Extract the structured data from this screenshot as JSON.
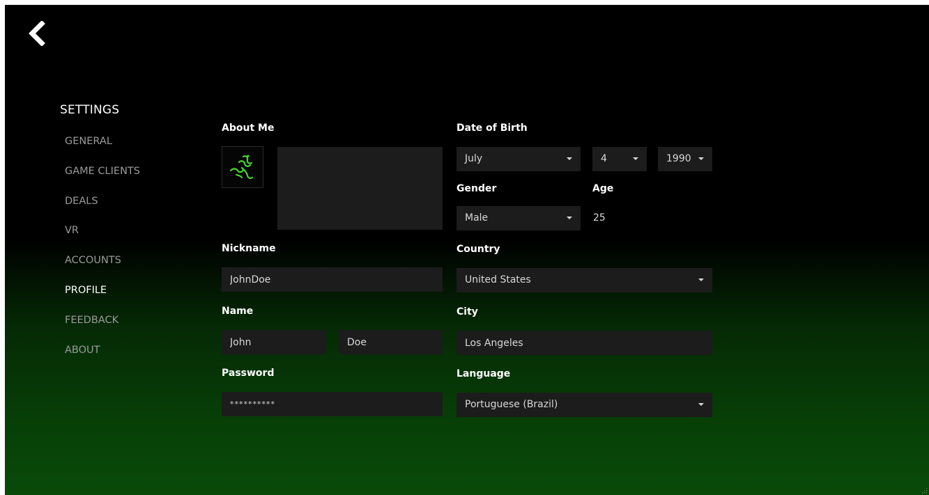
{
  "nav": {
    "title": "SETTINGS",
    "items": [
      {
        "label": "GENERAL",
        "active": false
      },
      {
        "label": "GAME CLIENTS",
        "active": false
      },
      {
        "label": "DEALS",
        "active": false
      },
      {
        "label": "VR",
        "active": false
      },
      {
        "label": "ACCOUNTS",
        "active": false
      },
      {
        "label": "PROFILE",
        "active": true
      },
      {
        "label": "FEEDBACK",
        "active": false
      },
      {
        "label": "ABOUT",
        "active": false
      }
    ]
  },
  "profile": {
    "about_me_label": "About Me",
    "about_me_value": "",
    "avatar_icon": "razer-snake-logo",
    "nickname_label": "Nickname",
    "nickname_value": "JohnDoe",
    "name_label": "Name",
    "first_name_value": "John",
    "last_name_value": "Doe",
    "password_label": "Password",
    "password_value": "**********",
    "dob_label": "Date of Birth",
    "dob_month": "July",
    "dob_day": "4",
    "dob_year": "1990",
    "gender_label": "Gender",
    "gender_value": "Male",
    "age_label": "Age",
    "age_value": "25",
    "country_label": "Country",
    "country_value": "United States",
    "city_label": "City",
    "city_value": "Los Angeles",
    "language_label": "Language",
    "language_value": "Portuguese (Brazil)"
  },
  "colors": {
    "accent": "#44d62c",
    "background_top": "#000000",
    "background_bottom": "#084a08",
    "field_bg": "#1c1c1c"
  }
}
